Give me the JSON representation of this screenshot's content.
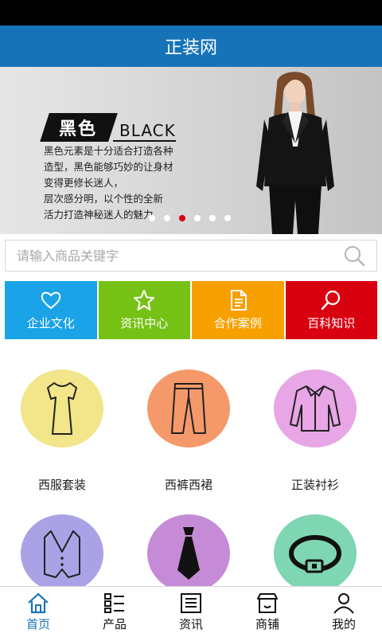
{
  "header": {
    "title": "正装网"
  },
  "banner": {
    "tag_cn": "黑色",
    "tag_en": "BLACK",
    "lines": [
      "黑色元素是十分适合打造各种",
      "造型，黑色能够巧妙的让身材",
      "变得更修长迷人，",
      "层次感分明，以个性的全新",
      "活力打造神秘迷人的魅力"
    ],
    "slide_count": 6,
    "active_slide": 3
  },
  "search": {
    "placeholder": "请输入商品关键字",
    "value": ""
  },
  "tiles": [
    {
      "label": "企业文化",
      "color": "#1aa3e6",
      "icon": "heart-icon"
    },
    {
      "label": "资讯中心",
      "color": "#76c115",
      "icon": "star-icon"
    },
    {
      "label": "合作案例",
      "color": "#f7a000",
      "icon": "document-icon"
    },
    {
      "label": "百科知识",
      "color": "#d90010",
      "icon": "search-icon"
    }
  ],
  "categories": [
    {
      "label": "西服套装",
      "color": "#f2e58a",
      "icon": "dress-icon"
    },
    {
      "label": "西裤西裙",
      "color": "#f5996b",
      "icon": "trousers-icon"
    },
    {
      "label": "正装衬衫",
      "color": "#e8a6e6",
      "icon": "shirt-icon"
    },
    {
      "label": "",
      "color": "#a9a3e6",
      "icon": "vest-icon"
    },
    {
      "label": "",
      "color": "#c58bd6",
      "icon": "tie-icon"
    },
    {
      "label": "",
      "color": "#7fd6b2",
      "icon": "belt-icon"
    }
  ],
  "tabbar": [
    {
      "label": "首页",
      "icon": "home-icon",
      "active": true
    },
    {
      "label": "产品",
      "icon": "list-icon",
      "active": false
    },
    {
      "label": "资讯",
      "icon": "news-icon",
      "active": false
    },
    {
      "label": "商铺",
      "icon": "store-icon",
      "active": false
    },
    {
      "label": "我的",
      "icon": "user-icon",
      "active": false
    }
  ],
  "colors": {
    "brand": "#1673b8",
    "dot_active": "#d7000f"
  }
}
